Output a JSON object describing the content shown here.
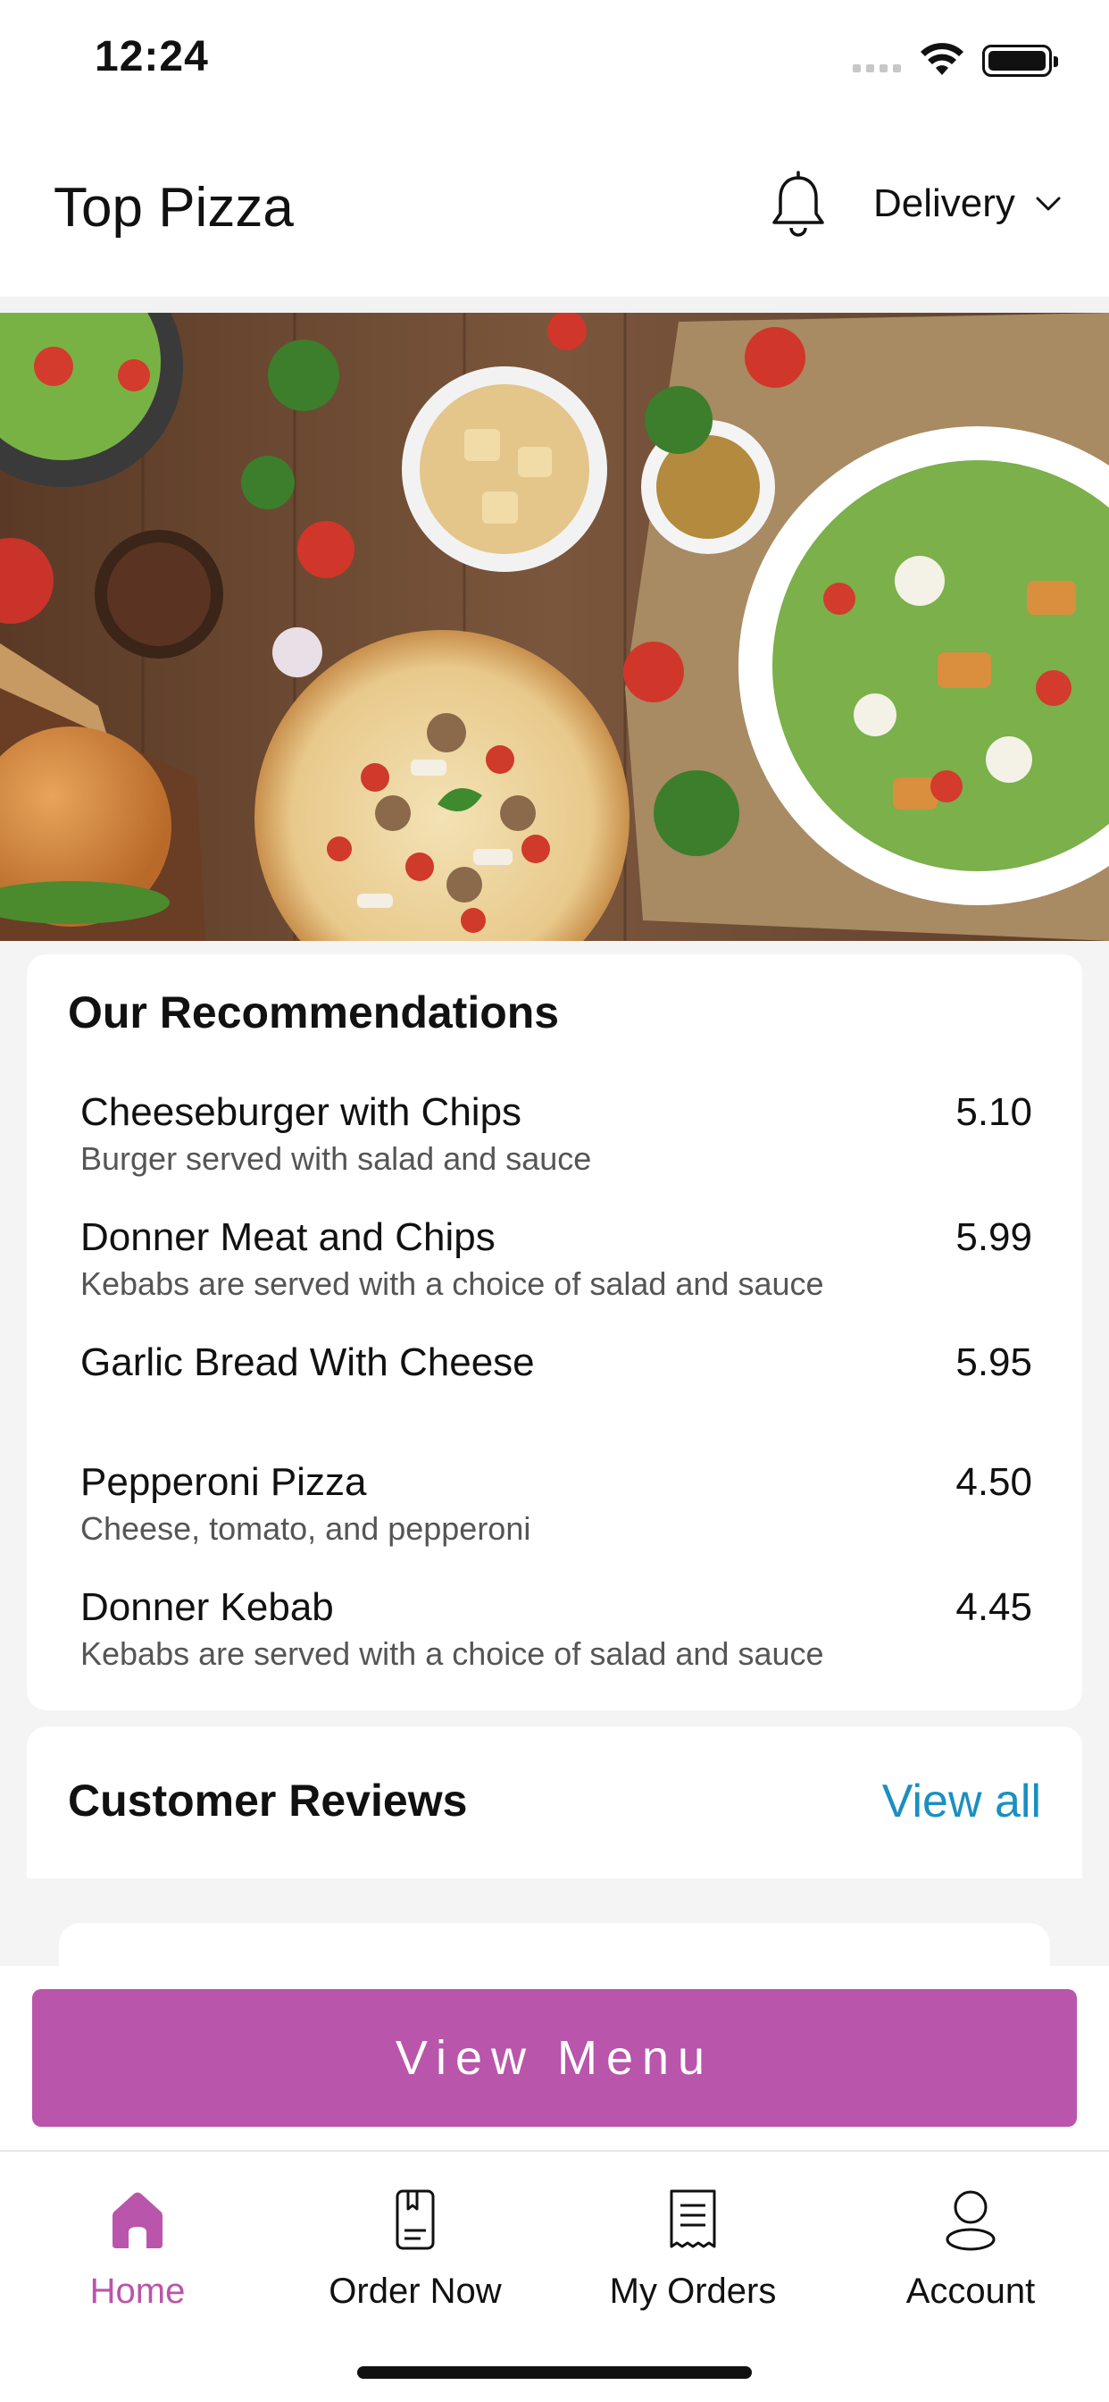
{
  "status_bar": {
    "time": "12:24"
  },
  "header": {
    "title": "Top Pizza",
    "delivery_label": "Delivery",
    "icons": {
      "notifications": "bell-icon",
      "dropdown": "chevron-down-icon"
    }
  },
  "recommendations": {
    "title": "Our Recommendations",
    "items": [
      {
        "name": "Cheeseburger with Chips",
        "description": "Burger served with salad and sauce",
        "price": "5.10"
      },
      {
        "name": "Donner Meat and Chips",
        "description": "Kebabs are served with a choice of salad and sauce",
        "price": "5.99"
      },
      {
        "name": "Garlic Bread With Cheese",
        "description": "",
        "price": "5.95"
      },
      {
        "name": "Pepperoni Pizza",
        "description": "Cheese, tomato, and pepperoni",
        "price": "4.50"
      },
      {
        "name": "Donner Kebab",
        "description": "Kebabs are served with a choice of salad and sauce",
        "price": "4.45"
      }
    ]
  },
  "reviews": {
    "title": "Customer Reviews",
    "view_all_label": "View all"
  },
  "view_menu_label": "View Menu",
  "tabs": [
    {
      "label": "Home",
      "icon": "home-icon",
      "active": true
    },
    {
      "label": "Order Now",
      "icon": "order-icon",
      "active": false
    },
    {
      "label": "My Orders",
      "icon": "receipt-icon",
      "active": false
    },
    {
      "label": "Account",
      "icon": "account-icon",
      "active": false
    }
  ],
  "colors": {
    "accent": "#b955aa",
    "link": "#1b8fc0"
  }
}
